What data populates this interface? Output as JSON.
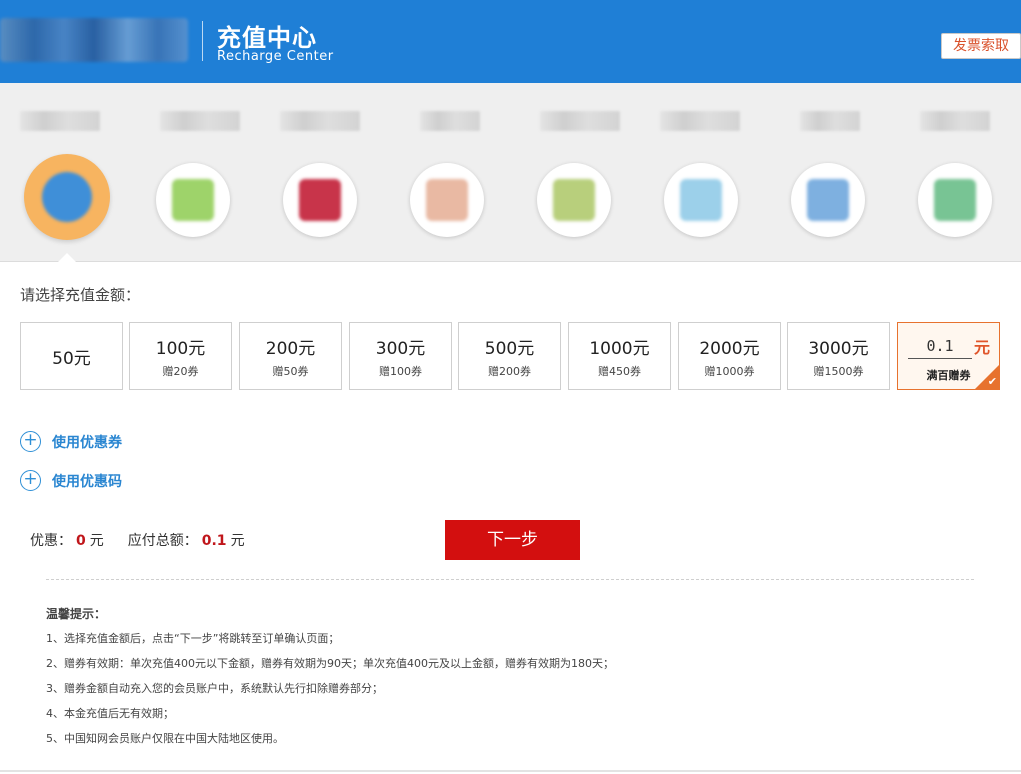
{
  "header": {
    "title": "充值中心",
    "subtitle": "Recharge Center",
    "invoice_button": "发票索取"
  },
  "categories": [
    {
      "name": "category-1",
      "icon": "globe-icon",
      "active": true,
      "color": "#3f8fd8"
    },
    {
      "name": "category-2",
      "icon": "chat-bubble-icon",
      "active": false,
      "color": "#9ed36a"
    },
    {
      "name": "category-3",
      "icon": "card-icon",
      "active": false,
      "color": "#c8344a"
    },
    {
      "name": "category-4",
      "icon": "box-icon",
      "active": false,
      "color": "#e9b9a3"
    },
    {
      "name": "category-5",
      "icon": "gift-icon",
      "active": false,
      "color": "#b8cf7c"
    },
    {
      "name": "category-6",
      "icon": "book-icon",
      "active": false,
      "color": "#9cd0ea"
    },
    {
      "name": "category-7",
      "icon": "tablet-icon",
      "active": false,
      "color": "#7eb0e0"
    },
    {
      "name": "category-8",
      "icon": "leaf-icon",
      "active": false,
      "color": "#78c494"
    }
  ],
  "amount_section": {
    "title": "请选择充值金额：",
    "options": [
      {
        "amount": "50元",
        "gift": ""
      },
      {
        "amount": "100元",
        "gift": "赠20券"
      },
      {
        "amount": "200元",
        "gift": "赠50券"
      },
      {
        "amount": "300元",
        "gift": "赠100券"
      },
      {
        "amount": "500元",
        "gift": "赠200券"
      },
      {
        "amount": "1000元",
        "gift": "赠450券"
      },
      {
        "amount": "2000元",
        "gift": "赠1000券"
      },
      {
        "amount": "3000元",
        "gift": "赠1500券"
      }
    ],
    "custom": {
      "value": "0.1",
      "unit": "元",
      "note": "满百赠券",
      "check": "✔"
    }
  },
  "use_coupon": {
    "icon": "plus-circle-icon",
    "label": "使用优惠券"
  },
  "use_code": {
    "icon": "plus-circle-icon",
    "label": "使用优惠码"
  },
  "totals": {
    "discount_label": "优惠：",
    "discount_value": "0",
    "discount_unit": "元",
    "total_label": "应付总额：",
    "total_value": "0.1",
    "total_unit": "元"
  },
  "next_button": "下一步",
  "tips": {
    "title": "温馨提示：",
    "items": [
      "1、选择充值金额后，点击“下一步”将跳转至订单确认页面；",
      "2、赠券有效期：单次充值400元以下金额，赠券有效期为90天；单次充值400元及以上金额，赠券有效期为180天；",
      "3、赠券金额自动充入您的会员账户中，系统默认先行扣除赠券部分；",
      "4、本金充值后无有效期；",
      "5、中国知网会员账户仅限在中国大陆地区使用。"
    ]
  },
  "colors": {
    "header_bg": "#1f7fd6",
    "accent_orange": "#e7722e",
    "next_button": "#d30f0f",
    "link_blue": "#2a86d1",
    "price_red": "#c0161b"
  }
}
